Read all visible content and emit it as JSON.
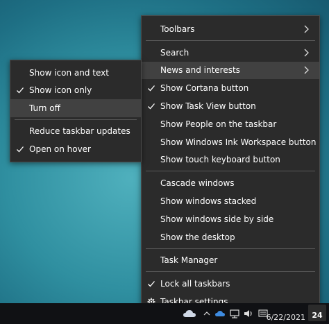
{
  "main_menu": {
    "items": [
      {
        "label": "Toolbars",
        "arrow": true,
        "checked": false
      },
      {
        "label": "Search",
        "arrow": true,
        "checked": false
      },
      {
        "label": "News and interests",
        "arrow": true,
        "checked": false
      },
      {
        "label": "Show Cortana button",
        "arrow": false,
        "checked": true
      },
      {
        "label": "Show Task View button",
        "arrow": false,
        "checked": true
      },
      {
        "label": "Show People on the taskbar",
        "arrow": false,
        "checked": false
      },
      {
        "label": "Show Windows Ink Workspace button",
        "arrow": false,
        "checked": false
      },
      {
        "label": "Show touch keyboard button",
        "arrow": false,
        "checked": false
      },
      {
        "label": "Cascade windows",
        "arrow": false,
        "checked": false
      },
      {
        "label": "Show windows stacked",
        "arrow": false,
        "checked": false
      },
      {
        "label": "Show windows side by side",
        "arrow": false,
        "checked": false
      },
      {
        "label": "Show the desktop",
        "arrow": false,
        "checked": false
      },
      {
        "label": "Task Manager",
        "arrow": false,
        "checked": false
      },
      {
        "label": "Lock all taskbars",
        "arrow": false,
        "checked": true
      },
      {
        "label": "Taskbar settings",
        "arrow": false,
        "checked": false,
        "icon": "gear-icon"
      }
    ]
  },
  "sub_menu": {
    "items": [
      {
        "label": "Show icon and text",
        "checked": false
      },
      {
        "label": "Show icon only",
        "checked": true
      },
      {
        "label": "Turn off",
        "checked": false
      },
      {
        "label": "Reduce taskbar updates",
        "checked": false
      },
      {
        "label": "Open on hover",
        "checked": true
      }
    ]
  },
  "taskbar": {
    "date": "6/22/2021",
    "notification_count": "24"
  },
  "colors": {
    "menu_bg": "#2b2b2b",
    "menu_hover": "#414141",
    "taskbar_bg": "#101114"
  }
}
